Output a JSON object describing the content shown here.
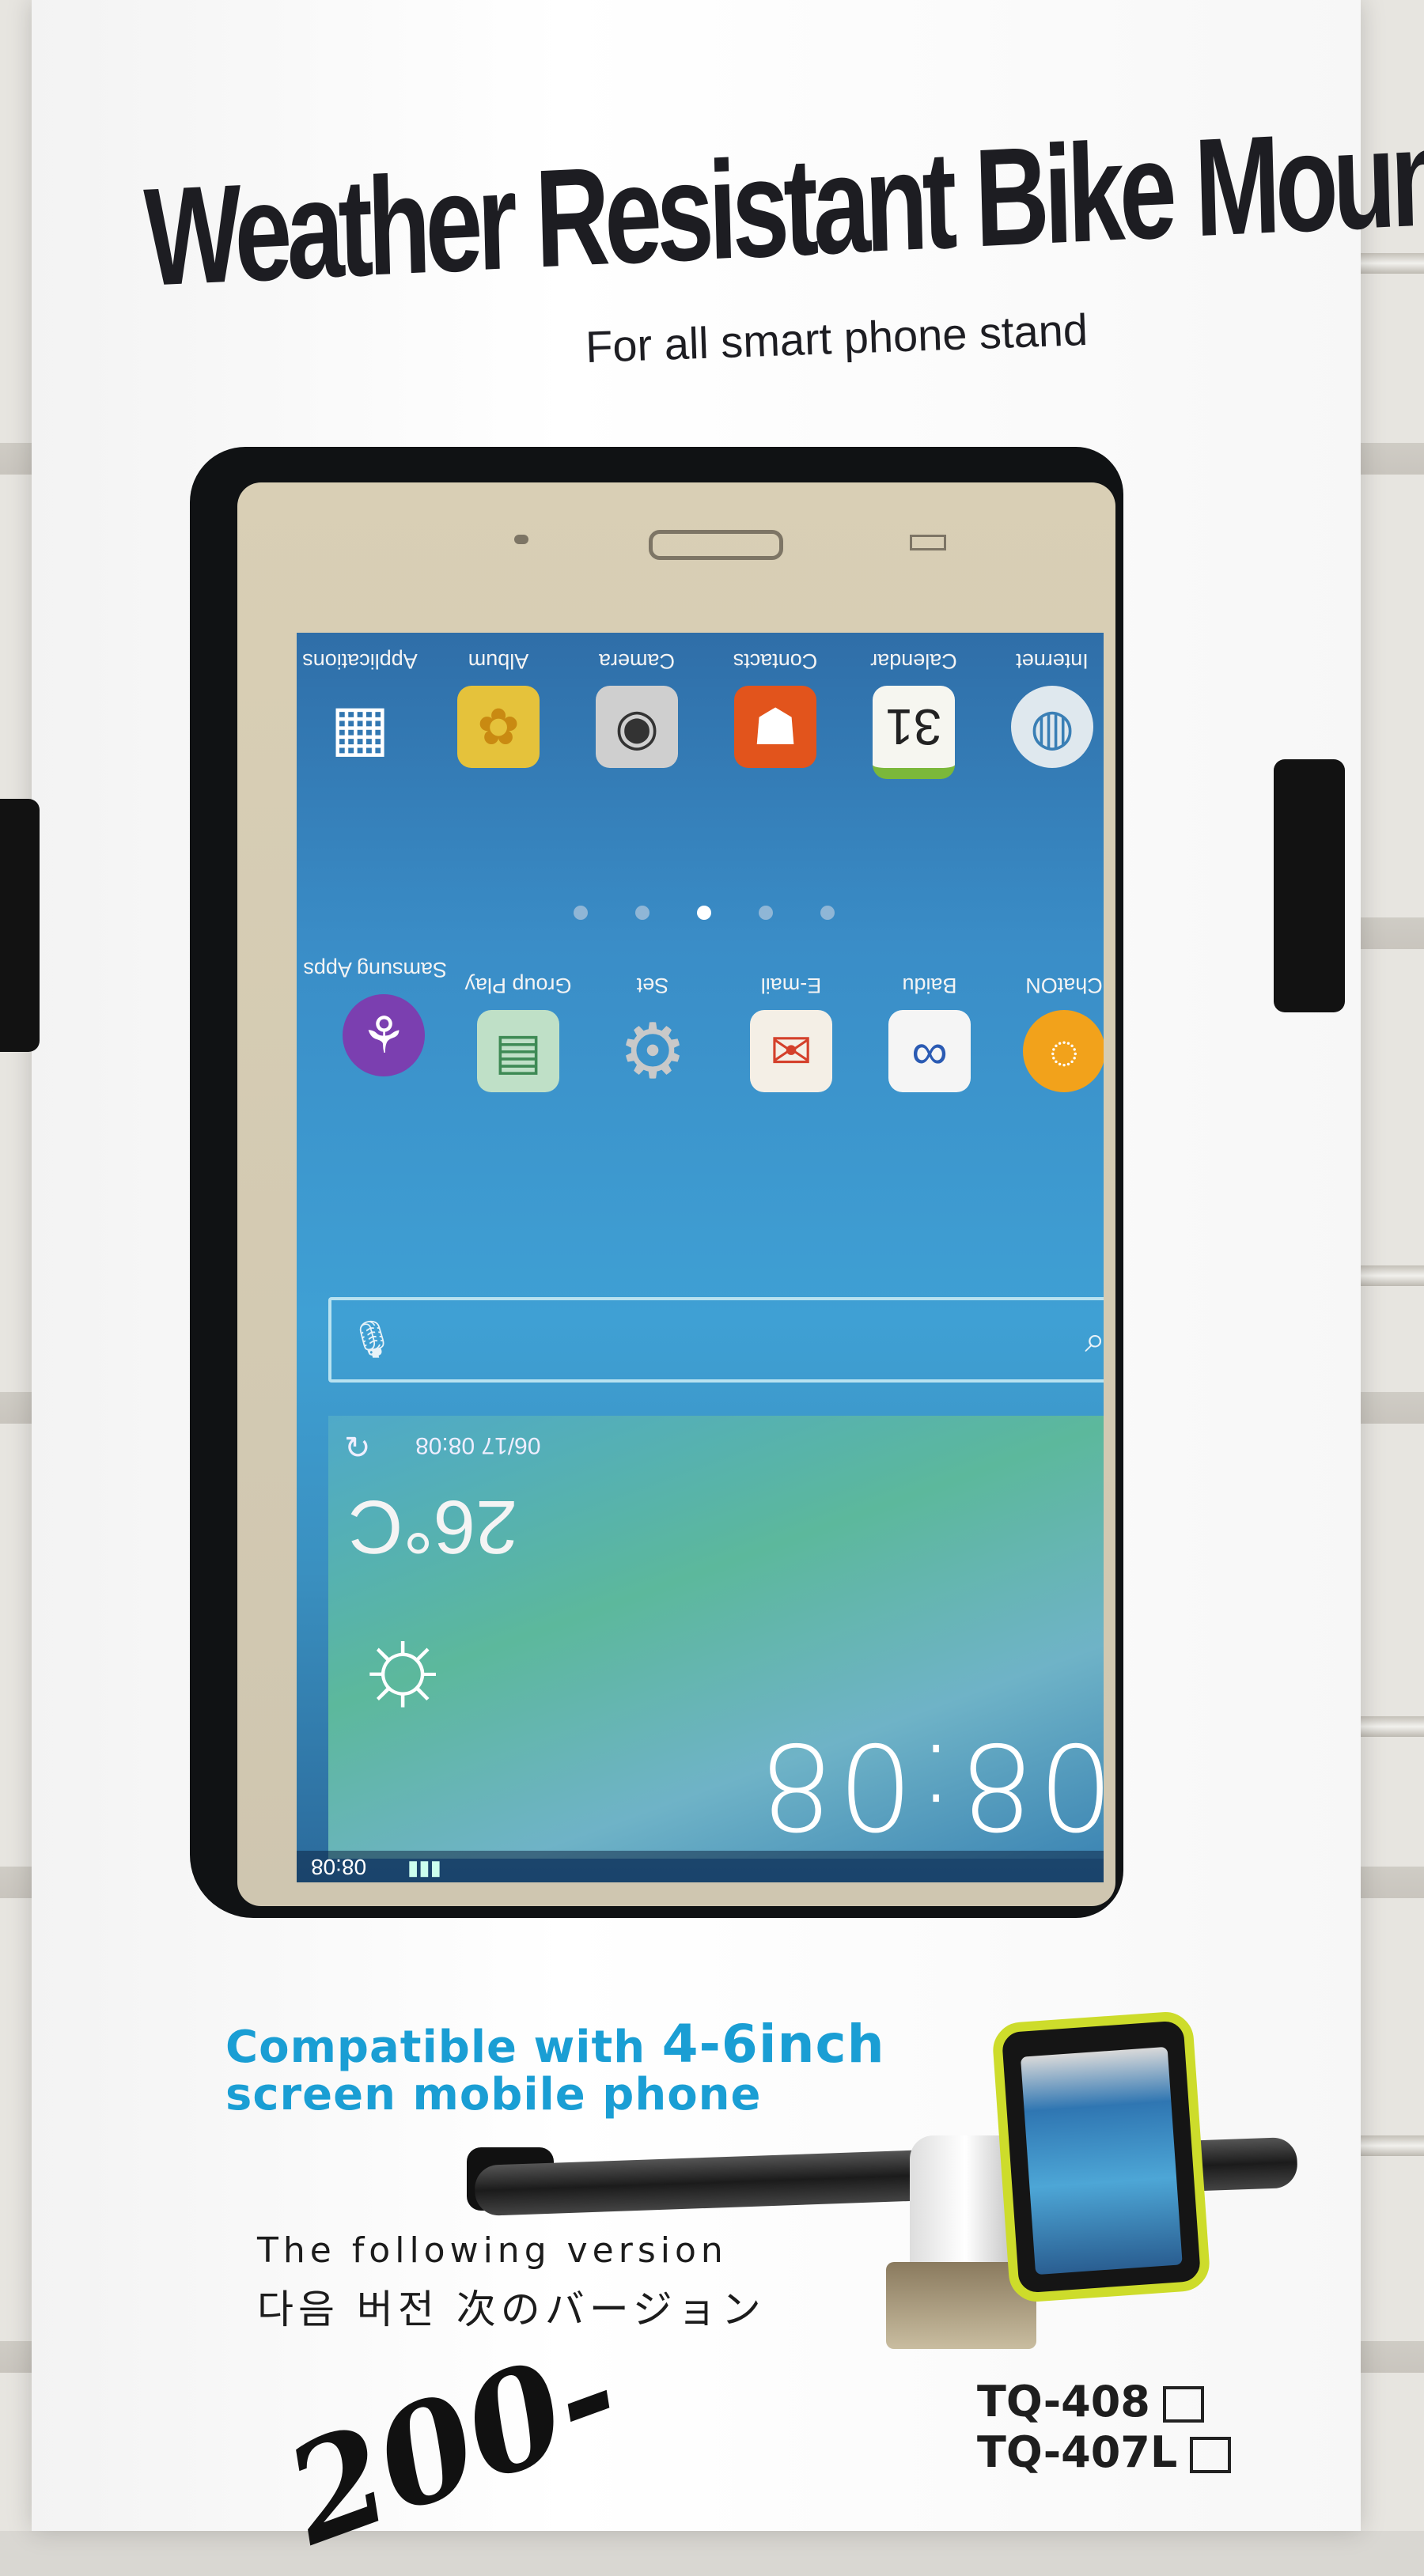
{
  "package": {
    "title": "Weather Resistant Bike Mount",
    "subtitle": "For all smart phone stand",
    "compat_line1_a": "Compatible with ",
    "compat_line1_b": "4-6inch",
    "compat_line2": "screen mobile phone",
    "following": "The following version",
    "korean_japanese": "다음 버전  次のバージョン",
    "handwritten_price": "200-",
    "models": [
      {
        "label": "TQ-408"
      },
      {
        "label": "TQ-407L"
      }
    ],
    "colors": {
      "accent": "#1a9ed4",
      "pouch_trim": "#cddc2b"
    }
  },
  "phone_screen": {
    "top_row": [
      {
        "label": "Applications",
        "icon": "grid-icon"
      },
      {
        "label": "Album",
        "icon": "album-icon"
      },
      {
        "label": "Camera",
        "icon": "camera-icon"
      },
      {
        "label": "Contacts",
        "icon": "contacts-icon"
      },
      {
        "label": "Calendar",
        "icon": "calendar-icon",
        "glyph": "31"
      },
      {
        "label": "Internet",
        "icon": "globe-icon"
      }
    ],
    "second_row": [
      {
        "label": "Samsung Apps",
        "icon": "samsung-apps-icon"
      },
      {
        "label": "Group Play",
        "icon": "group-play-icon"
      },
      {
        "label": "Set",
        "icon": "settings-icon"
      },
      {
        "label": "E-mail",
        "icon": "email-icon"
      },
      {
        "label": "Baidu",
        "icon": "baidu-icon"
      },
      {
        "label": "ChatON",
        "icon": "chaton-icon"
      }
    ],
    "weather": {
      "date": "06/17 08:08",
      "temperature": "26°C",
      "clock": "08:08"
    },
    "status_time": "08:08"
  }
}
